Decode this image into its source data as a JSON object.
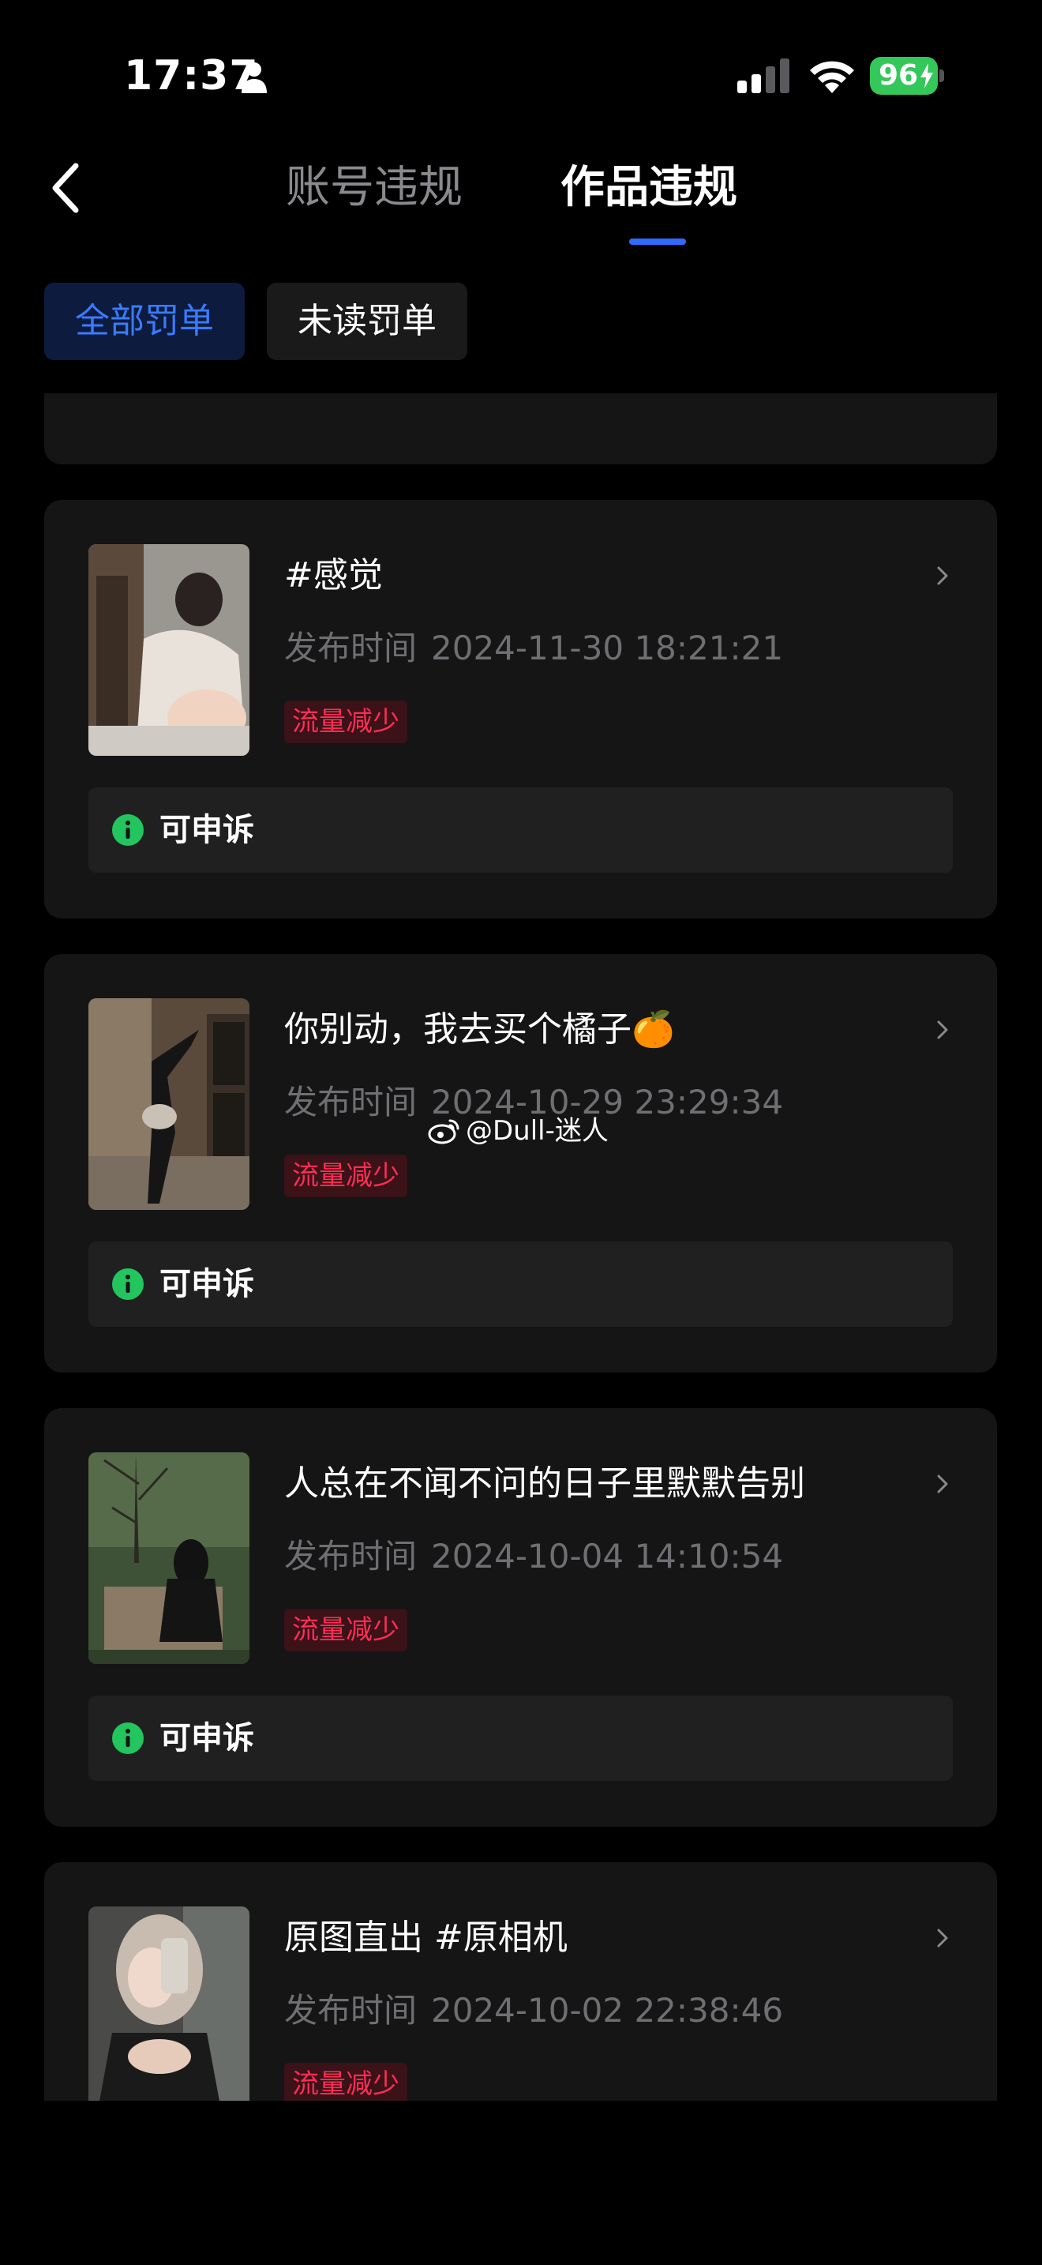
{
  "status_bar": {
    "time": "17:37",
    "battery": "96",
    "icons": [
      "person-icon",
      "signal-icon",
      "wifi-icon",
      "battery-icon",
      "bolt-icon"
    ]
  },
  "header": {
    "back_icon": "chevron-left-icon",
    "tabs": [
      {
        "label": "账号违规",
        "active": false
      },
      {
        "label": "作品违规",
        "active": true
      }
    ],
    "accent_color": "#2d6cff"
  },
  "filters": [
    {
      "label": "全部罚单",
      "active": true
    },
    {
      "label": "未读罚单",
      "active": false
    }
  ],
  "list": {
    "items": [
      {
        "title": "#感觉",
        "time_label": "发布时间",
        "time_value": "2024-11-30 18:21:21",
        "badge": "流量减少",
        "appeal": "可申诉"
      },
      {
        "title": "你别动，我去买个橘子🍊",
        "time_label": "发布时间",
        "time_value": "2024-10-29 23:29:34",
        "badge": "流量减少",
        "appeal": "可申诉"
      },
      {
        "title": "人总在不闻不问的日子里默默告别",
        "time_label": "发布时间",
        "time_value": "2024-10-04 14:10:54",
        "badge": "流量减少",
        "appeal": "可申诉"
      },
      {
        "title": "原图直出 #原相机",
        "time_label": "发布时间",
        "time_value": "2024-10-02 22:38:46",
        "badge": "流量减少"
      }
    ],
    "badge_color": "#ff2d55",
    "appeal_icon_color": "#22c55e"
  },
  "watermark": {
    "text": "@Dull-迷人",
    "icon": "weibo-icon"
  }
}
